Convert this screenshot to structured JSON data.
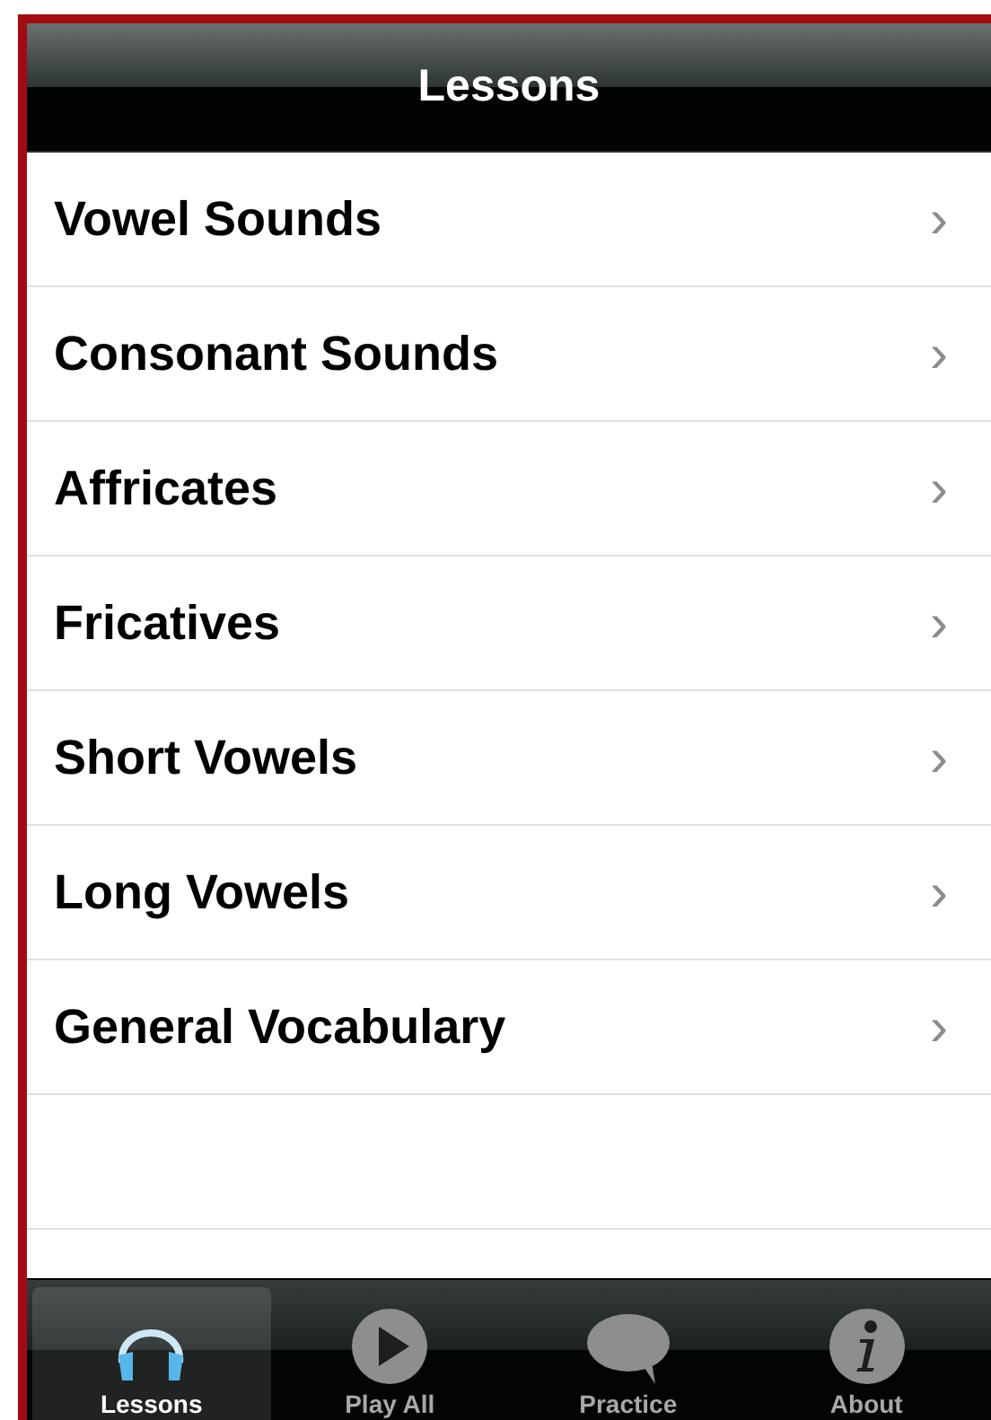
{
  "title": "Lessons",
  "lessons": [
    {
      "label": "Vowel Sounds",
      "chevron": "›"
    },
    {
      "label": "Consonant Sounds",
      "chevron": "›"
    },
    {
      "label": "Affricates",
      "chevron": "›"
    },
    {
      "label": "Fricatives",
      "chevron": "›"
    },
    {
      "label": "Short Vowels",
      "chevron": "›"
    },
    {
      "label": "Long Vowels",
      "chevron": "›"
    },
    {
      "label": "General Vocabulary",
      "chevron": "›"
    }
  ],
  "tabs": [
    {
      "label": "Lessons",
      "kind": "headphones",
      "selected": true
    },
    {
      "label": "Play All",
      "kind": "play",
      "selected": false
    },
    {
      "label": "Practice",
      "kind": "bubble",
      "selected": false
    },
    {
      "label": "About",
      "kind": "info",
      "selected": false
    }
  ]
}
